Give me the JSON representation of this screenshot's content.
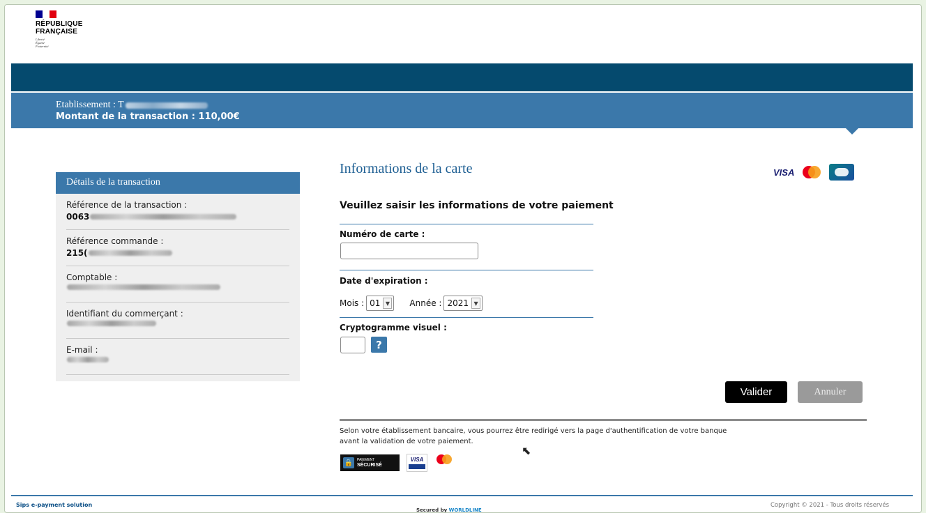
{
  "header": {
    "logo": {
      "line1": "RÉPUBLIQUE",
      "line2": "FRANÇAISE",
      "motto": [
        "Liberté",
        "Égalité",
        "Fraternité"
      ],
      "flag_colors": [
        "#000091",
        "#ffffff",
        "#e1000f"
      ]
    }
  },
  "banner": {
    "etablissement_label": "Etablissement : T",
    "montant_label": "Montant de la transaction : 110,00€"
  },
  "details": {
    "title": "Détails de la transaction",
    "rows": [
      {
        "label": "Référence de la transaction :",
        "value_prefix": "0063"
      },
      {
        "label": "Référence commande :",
        "value_prefix": "215("
      },
      {
        "label": "Comptable :",
        "value_prefix": ""
      },
      {
        "label": "Identifiant du commerçant :",
        "value_prefix": ""
      },
      {
        "label": "E-mail :",
        "value_prefix": ""
      }
    ]
  },
  "form": {
    "title": "Informations de la carte",
    "card_brands": [
      "VISA",
      "mastercard-icon",
      "cb-icon"
    ],
    "intro": "Veuillez saisir les informations de votre paiement",
    "card_number_label": "Numéro de carte :",
    "card_number_value": "",
    "expiry_label": "Date d'expiration :",
    "month_label": "Mois :",
    "month_value": "01",
    "year_label": "Année :",
    "year_value": "2021",
    "cvv_label": "Cryptogramme visuel :",
    "cvv_value": "",
    "help_label": "?",
    "validate_label": "Valider",
    "cancel_label": "Annuler"
  },
  "notice": {
    "text": "Selon votre établissement bancaire, vous pourrez être redirigé vers la page d'authentification de votre banque avant la validation de votre paiement.",
    "secure_badge_line1": "PAIEMENT",
    "secure_badge_line2": "SÉCURISÉ",
    "visa_badge": "VISA"
  },
  "footer": {
    "left": "Sips e-payment solution",
    "middle_prefix": "Secured by",
    "middle_brand": "WORLDLINE",
    "right": "Copyright © 2021 - Tous droits réservés"
  },
  "colors": {
    "dark_band": "#054a6e",
    "light_band": "#3b78aa",
    "title_blue": "#1e5f93"
  }
}
